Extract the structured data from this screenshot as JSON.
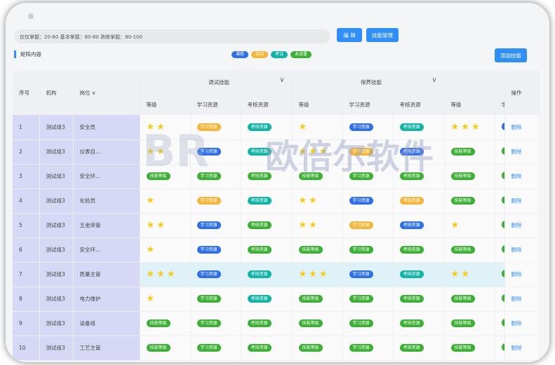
{
  "breadcrumb": "级",
  "mastery_text": "仅仅掌握：20-60  基本掌握：60-80  熟练掌握：80-100",
  "buttons": {
    "edit": "编 辑",
    "skill_manage": "技能管理",
    "add_skill": "添加技能"
  },
  "section_title": "矩阵内容",
  "legend": [
    {
      "label": "课程",
      "color": "blue"
    },
    {
      "label": "培训",
      "color": "orange"
    },
    {
      "label": "考试",
      "color": "teal"
    },
    {
      "label": "未设置",
      "color": "green"
    }
  ],
  "table": {
    "headers": {
      "no": "序号",
      "org": "机构",
      "post": "岗位",
      "op": "操作"
    },
    "groups": [
      "调试技能",
      "保养技能",
      ""
    ],
    "subheaders": [
      "等级",
      "学习资源",
      "考核资源",
      "等级",
      "学习资源",
      "考核资源",
      "等级",
      "学"
    ],
    "rows": [
      {
        "no": "1",
        "org": "测试组3",
        "post": "安全员",
        "cells": [
          {
            "stars": "★★"
          },
          {
            "tag": "学习资源",
            "c": "orange"
          },
          {
            "tag": "考核资源",
            "c": "teal"
          },
          {
            "stars": "★"
          },
          {
            "tag": "学习资源",
            "c": "blue"
          },
          {
            "tag": "考核资源",
            "c": "teal"
          },
          {
            "stars": "★★★"
          },
          {
            "tag": "",
            "c": "blue"
          }
        ],
        "op": "删除"
      },
      {
        "no": "2",
        "org": "测试组3",
        "post": "仪表自...",
        "cells": [
          {
            "stars": "★★"
          },
          {
            "tag": "学习资源",
            "c": "blue"
          },
          {
            "tag": "考核资源",
            "c": "teal"
          },
          {
            "stars": "★★★"
          },
          {
            "tag": "学习资源",
            "c": "orange"
          },
          {
            "tag": "考核资源",
            "c": "blue"
          },
          {
            "tag": "技能等级",
            "c": "green"
          },
          {
            "tag": "",
            "c": "green"
          }
        ],
        "op": "删除"
      },
      {
        "no": "3",
        "org": "测试组3",
        "post": "安全环...",
        "cells": [
          {
            "tag": "技能等级",
            "c": "green"
          },
          {
            "tag": "学习资源",
            "c": "green"
          },
          {
            "tag": "考核资源",
            "c": "green"
          },
          {
            "tag": "技能等级",
            "c": "green"
          },
          {
            "tag": "学习资源",
            "c": "green"
          },
          {
            "tag": "考核资源",
            "c": "green"
          },
          {
            "tag": "技能等级",
            "c": "green"
          },
          {
            "tag": "",
            "c": "green"
          }
        ],
        "op": "删除"
      },
      {
        "no": "4",
        "org": "测试组3",
        "post": "化验员",
        "cells": [
          {
            "stars": "★"
          },
          {
            "tag": "学习资源",
            "c": "orange"
          },
          {
            "tag": "考核资源",
            "c": "teal"
          },
          {
            "stars": "★★"
          },
          {
            "tag": "学习资源",
            "c": "blue"
          },
          {
            "tag": "考核资源",
            "c": "orange"
          },
          {
            "tag": "技能等级",
            "c": "green"
          },
          {
            "tag": "",
            "c": "green"
          }
        ],
        "op": "删除"
      },
      {
        "no": "5",
        "org": "测试组3",
        "post": "五金库管",
        "cells": [
          {
            "stars": "★★"
          },
          {
            "tag": "学习资源",
            "c": "blue"
          },
          {
            "tag": "考核资源",
            "c": "green"
          },
          {
            "stars": "★★"
          },
          {
            "tag": "学习资源",
            "c": "orange"
          },
          {
            "tag": "考核资源",
            "c": "blue"
          },
          {
            "stars": "★"
          },
          {
            "tag": "",
            "c": "green"
          }
        ],
        "op": "删除"
      },
      {
        "no": "6",
        "org": "测试组3",
        "post": "安全环...",
        "cells": [
          {
            "stars": "★"
          },
          {
            "tag": "学习资源",
            "c": "blue"
          },
          {
            "tag": "考核资源",
            "c": "green"
          },
          {
            "tag": "技能等级",
            "c": "green"
          },
          {
            "tag": "学习资源",
            "c": "green"
          },
          {
            "tag": "考核资源",
            "c": "green"
          },
          {
            "tag": "技能等级",
            "c": "green"
          },
          {
            "tag": "",
            "c": "green"
          }
        ],
        "op": "删除"
      },
      {
        "no": "7",
        "org": "测试组3",
        "post": "质量主管",
        "hl": true,
        "cells": [
          {
            "stars": "★★★"
          },
          {
            "tag": "学习资源",
            "c": "blue"
          },
          {
            "tag": "考核资源",
            "c": "teal"
          },
          {
            "stars": "★★★"
          },
          {
            "tag": "学习资源",
            "c": "blue"
          },
          {
            "tag": "考核资源",
            "c": "teal"
          },
          {
            "stars": "★★"
          },
          {
            "tag": "",
            "c": "green"
          }
        ],
        "op": "删除"
      },
      {
        "no": "8",
        "org": "测试组3",
        "post": "电力维护",
        "cells": [
          {
            "stars": "★"
          },
          {
            "tag": "学习资源",
            "c": "green"
          },
          {
            "tag": "考核资源",
            "c": "teal"
          },
          {
            "tag": "技能等级",
            "c": "green"
          },
          {
            "tag": "学习资源",
            "c": "green"
          },
          {
            "tag": "考核资源",
            "c": "green"
          },
          {
            "tag": "技能等级",
            "c": "green"
          },
          {
            "tag": "",
            "c": "green"
          }
        ],
        "op": "删除"
      },
      {
        "no": "9",
        "org": "测试组3",
        "post": "设备组",
        "cells": [
          {
            "tag": "技能等级",
            "c": "green"
          },
          {
            "tag": "学习资源",
            "c": "green"
          },
          {
            "tag": "考核资源",
            "c": "green"
          },
          {
            "tag": "技能等级",
            "c": "green"
          },
          {
            "tag": "学习资源",
            "c": "green"
          },
          {
            "tag": "考核资源",
            "c": "green"
          },
          {
            "tag": "技能等级",
            "c": "green"
          },
          {
            "tag": "",
            "c": "green"
          }
        ],
        "op": "删除"
      },
      {
        "no": "10",
        "org": "测试组3",
        "post": "工艺主管",
        "cells": [
          {
            "tag": "技能等级",
            "c": "green"
          },
          {
            "tag": "学习资源",
            "c": "green"
          },
          {
            "tag": "考核资源",
            "c": "green"
          },
          {
            "tag": "技能等级",
            "c": "green"
          },
          {
            "tag": "学习资源",
            "c": "green"
          },
          {
            "tag": "考核资源",
            "c": "green"
          },
          {
            "tag": "技能等级",
            "c": "green"
          },
          {
            "tag": "",
            "c": "green"
          }
        ],
        "op": "删除"
      }
    ]
  },
  "watermark": {
    "line1": "BR",
    "line2": "欧倍尔软件"
  },
  "colors": {
    "primary": "#2f8ff7",
    "star": "#f7ca18",
    "fixed_col_bg": "#d6d8f6",
    "highlight_row": "#dff2f7"
  }
}
